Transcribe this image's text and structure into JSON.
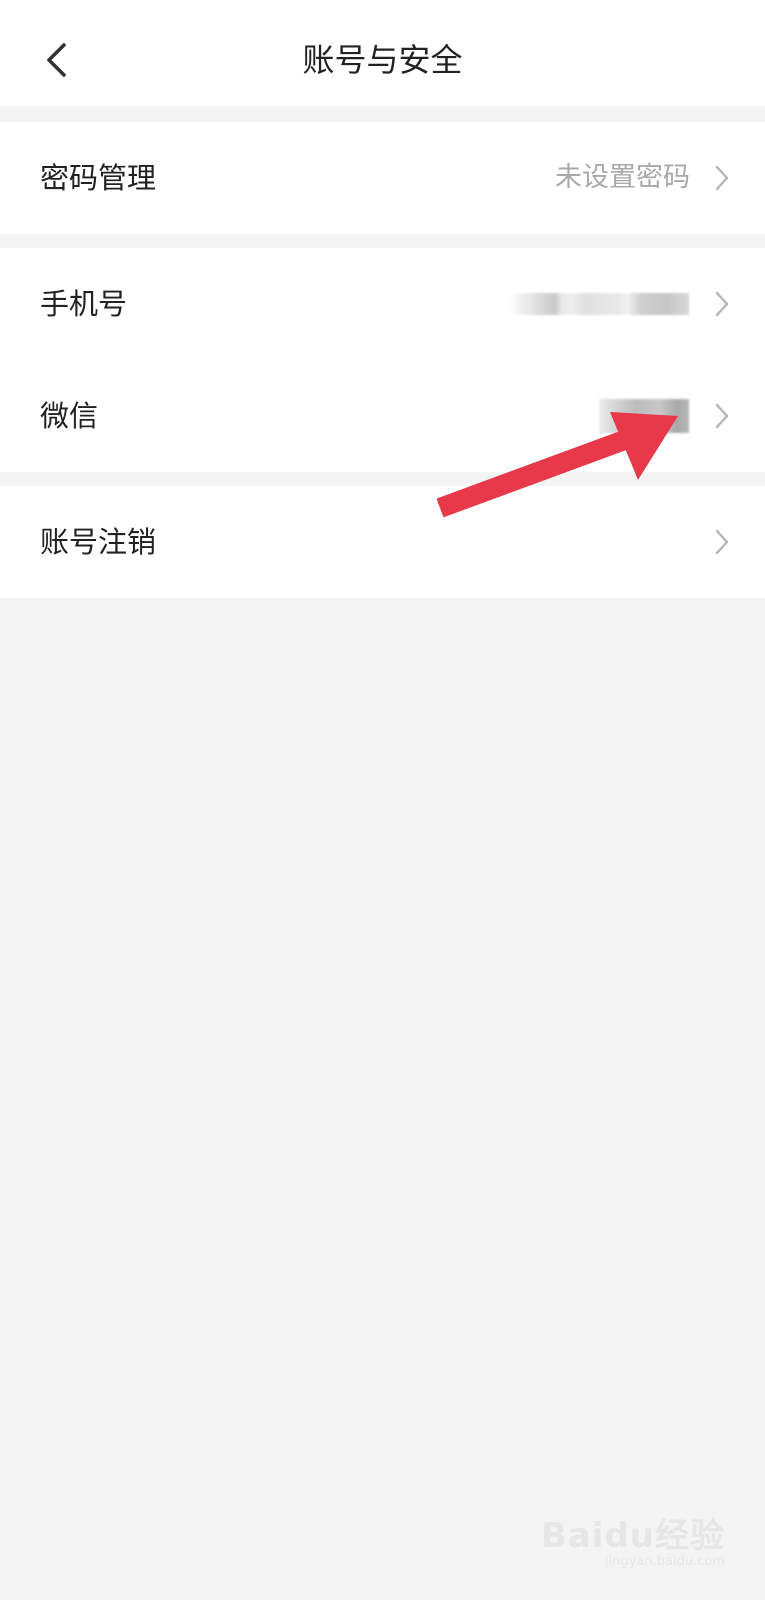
{
  "header": {
    "title": "账号与安全",
    "back_icon": "chevron-left-icon"
  },
  "groups": [
    {
      "rows": [
        {
          "label": "密码管理",
          "value": "未设置密码"
        }
      ]
    },
    {
      "rows": [
        {
          "label": "手机号",
          "value": ""
        },
        {
          "label": "微信",
          "value": ""
        }
      ]
    },
    {
      "rows": [
        {
          "label": "账号注销",
          "value": ""
        }
      ]
    }
  ],
  "watermark": {
    "brand": "Baidu经验",
    "url": "jingyan.baidu.com"
  },
  "colors": {
    "background": "#f4f4f4",
    "card": "#ffffff",
    "text_primary": "#222222",
    "text_secondary": "#a9a9a9",
    "chevron": "#b5b5b5",
    "annotation_arrow": "#e8394a"
  }
}
